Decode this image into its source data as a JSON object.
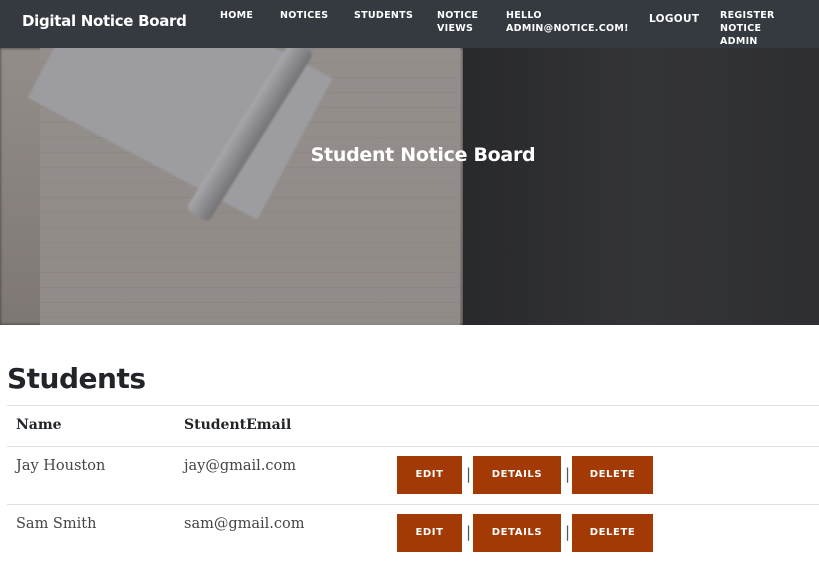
{
  "navbar": {
    "brand": "Digital Notice Board",
    "links": {
      "home": "HOME",
      "notices": "NOTICES",
      "students": "STUDENTS",
      "notice_views": "NOTICE\nVIEWS",
      "hello": "HELLO\nADMIN@NOTICE.COM!",
      "logout": "LOGOUT",
      "register": "REGISTER NOTICE\nADMIN"
    }
  },
  "hero": {
    "title": "Student Notice Board"
  },
  "main": {
    "heading": "Students",
    "table": {
      "columns": [
        "Name",
        "StudentEmail"
      ],
      "rows": [
        {
          "name": "Jay Houston",
          "email": "jay@gmail.com"
        },
        {
          "name": "Sam Smith",
          "email": "sam@gmail.com"
        }
      ],
      "actions": {
        "edit": "EDIT",
        "details": "DETAILS",
        "delete": "DELETE",
        "separator": "|"
      }
    }
  },
  "colors": {
    "navbar_bg": "#343a40",
    "action_button_bg": "#a33a06"
  }
}
